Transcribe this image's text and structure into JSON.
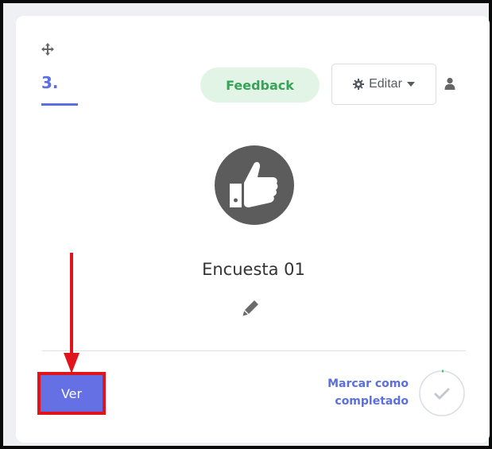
{
  "card": {
    "step_number": "3.",
    "feedback_badge": "Feedback",
    "edit_button_label": "Editar",
    "activity_title": "Encuesta 01",
    "view_button_label": "Ver",
    "complete_label_line1": "Marcar como",
    "complete_label_line2": "completado"
  },
  "icons": {
    "move": "move-icon",
    "gear": "gear-icon",
    "caret": "caret-down-icon",
    "user": "user-icon",
    "thumbs_up": "thumbs-up-icon",
    "pencil": "pencil-icon",
    "check": "check-icon"
  },
  "colors": {
    "accent": "#5b6fe0",
    "feedback_bg": "#e2f4e6",
    "feedback_text": "#36a357",
    "annotation_red": "#e0141d",
    "button_bg": "#6470e3"
  }
}
